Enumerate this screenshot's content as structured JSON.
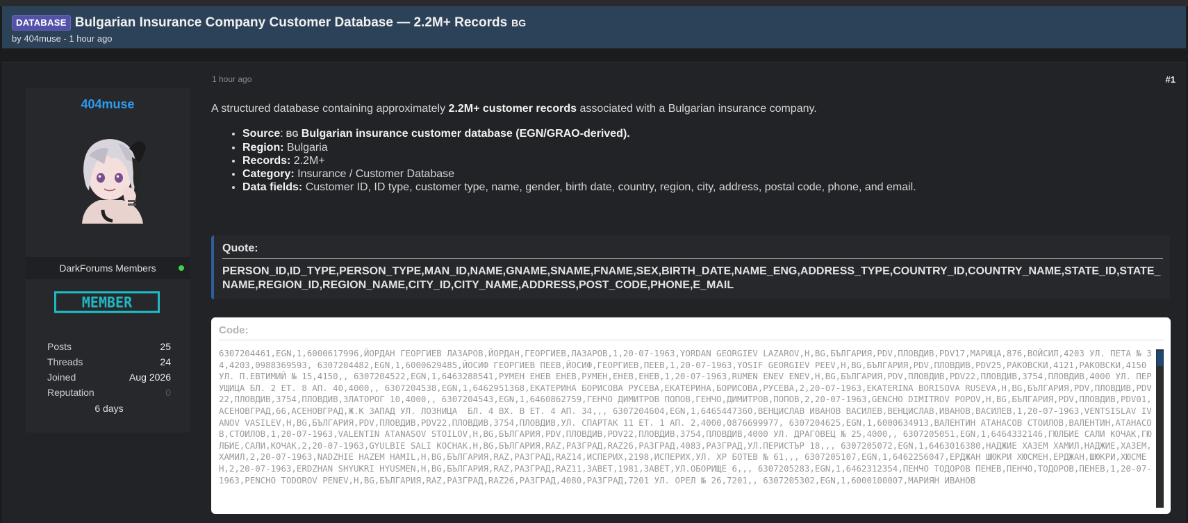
{
  "thread": {
    "prefix": "DATABASE",
    "title": "Bulgarian Insurance Company Customer Database — 2.2M+ Records",
    "flag": "BG",
    "meta": "by 404muse - 1 hour ago"
  },
  "user": {
    "name": "404muse",
    "group": "DarkForums Members",
    "badge": "MEMBER",
    "stats": [
      {
        "label": "Posts",
        "value": "25"
      },
      {
        "label": "Threads",
        "value": "24"
      },
      {
        "label": "Joined",
        "value": "Aug 2026"
      },
      {
        "label": "Reputation",
        "value": "0"
      }
    ],
    "time_online": "6 days"
  },
  "post": {
    "date": "1 hour ago",
    "number": "#1",
    "intro_before": "A structured database containing approximately ",
    "intro_bold": "2.2M+ customer records",
    "intro_after": " associated with a Bulgarian insurance company.",
    "items": [
      {
        "label": "Source",
        "sep": ":",
        "flag": "BG",
        "value": "Bulgarian insurance customer database (EGN/GRAO-derived)."
      },
      {
        "label": "Region:",
        "value": " Bulgaria"
      },
      {
        "label": "Records:",
        "value": " 2.2M+"
      },
      {
        "label": "Category:",
        "value": " Insurance / Customer Database"
      },
      {
        "label": "Data fields:",
        "value": " Customer ID, ID type, customer type, name, gender, birth date, country, region, city, address, postal code, phone, and email."
      }
    ]
  },
  "quote": {
    "title": "Quote:",
    "text": "PERSON_ID,ID_TYPE,PERSON_TYPE,MAN_ID,NAME,GNAME,SNAME,FNAME,SEX,BIRTH_DATE,NAME_ENG,ADDRESS_TYPE,COUNTRY_ID,COUNTRY_NAME,STATE_ID,STATE_NAME,REGION_ID,REGION_NAME,CITY_ID,CITY_NAME,ADDRESS,POST_CODE,PHONE,E_MAIL"
  },
  "code": {
    "title": "Code:",
    "text": "6307204461,EGN,1,6000617996,ЙОРДАН ГЕОРГИЕВ ЛАЗАРОВ,ЙОРДАН,ГЕОРГИЕВ,ЛАЗАРОВ,1,20-07-1963,YORDAN GEORGIEV LAZAROV,H,BG,БЪЛГАРИЯ,PDV,ПЛОВДИВ,PDV17,МАРИЦА,876,ВОЙСИЛ,4203 УЛ. ПЕТА № 34,4203,0988369593, 6307204482,EGN,1,6000629485,ЙОСИФ ГЕОРГИЕВ ПЕЕВ,ЙОСИФ,ГЕОРГИЕВ,ПЕЕВ,1,20-07-1963,YOSIF GEORGIEV PEEV,H,BG,БЪЛГАРИЯ,PDV,ПЛОВДИВ,PDV25,РАКОВСКИ,4121,РАКОВСКИ,4150 УЛ. П.ЕВТИМИЙ № 15,4150,, 6307204522,EGN,1,6463288541,РУМЕН ЕНЕВ ЕНЕВ,РУМЕН,ЕНЕВ,ЕНЕВ,1,20-07-1963,RUMEN ENEV ENEV,H,BG,БЪЛГАРИЯ,PDV,ПЛОВДИВ,PDV22,ПЛОВДИВ,3754,ПЛОВДИВ,4000 УЛ. ПЕРУЩИЦА БЛ. 2 ЕТ. 8 АП. 40,4000,, 6307204538,EGN,1,6462951368,ЕКАТЕРИНА БОРИСОВА РУСЕВА,ЕКАТЕРИНА,БОРИСОВА,РУСЕВА,2,20-07-1963,EKATERINA BORISOVA RUSEVA,H,BG,БЪЛГАРИЯ,PDV,ПЛОВДИВ,PDV22,ПЛОВДИВ,3754,ПЛОВДИВ,ЗЛАТОРОГ 10,4000,, 6307204543,EGN,1,6460862759,ГЕНЧО ДИМИТРОВ ПОПОВ,ГЕНЧО,ДИМИТРОВ,ПОПОВ,2,20-07-1963,GENCHO DIMITROV POPOV,H,BG,БЪЛГАРИЯ,PDV,ПЛОВДИВ,PDV01,АСЕНОВГРАД,66,АСЕНОВГРАД,Ж.К ЗАПАД УЛ. ЛОЗНИЦА  БЛ. 4 ВХ. В ЕТ. 4 АП. 34,,, 6307204604,EGN,1,6465447360,ВЕНЦИСЛАВ ИВАНОВ ВАСИЛЕВ,ВЕНЦИСЛАВ,ИВАНОВ,ВАСИЛЕВ,1,20-07-1963,VENTSISLAV IVANOV VASILEV,H,BG,БЪЛГАРИЯ,PDV,ПЛОВДИВ,PDV22,ПЛОВДИВ,3754,ПЛОВДИВ,УЛ. СПАРТАК 11 ЕТ. 1 АП. 2,4000,0876699977, 6307204625,EGN,1,6000634913,ВАЛЕНТИН АТАНАСОВ СТОИЛОВ,ВАЛЕНТИН,АТАНАСОВ,СТОИЛОВ,1,20-07-1963,VALENTIN ATANASOV STOILOV,H,BG,БЪЛГАРИЯ,PDV,ПЛОВДИВ,PDV22,ПЛОВДИВ,3754,ПЛОВДИВ,4000 УЛ. ДРАГОВЕЦ № 25,4000,, 6307205051,EGN,1,6464332146,ГЮЛБИЕ САЛИ КОЧАК,ГЮЛБИЕ,САЛИ,КОЧАК,2,20-07-1963,GYULBIE SALI KOCHAK,H,BG,БЪЛГАРИЯ,RAZ,РАЗГРАД,RAZ26,РАЗГРАД,4083,РАЗГРАД,УЛ.ПЕРИСТЪР 18,,, 6307205072,EGN,1,6463016380,НАДЖИЕ ХАЗЕМ ХАМИЛ,НАДЖИЕ,ХАЗЕМ,ХАМИЛ,2,20-07-1963,NADZHIE HAZEM HAMIL,H,BG,БЪЛГАРИЯ,RAZ,РАЗГРАД,RAZ14,ИСПЕРИХ,2198,ИСПЕРИХ,УЛ. ХР БОТЕВ № 61,,, 6307205107,EGN,1,6462256047,ЕРДЖАН ШЮКРИ ХЮСМЕН,ЕРДЖАН,ШЮКРИ,ХЮСМЕН,2,20-07-1963,ERDZHAN SHYUKRI HYUSMEN,H,BG,БЪЛГАРИЯ,RAZ,РАЗГРАД,RAZ11,ЗАВЕТ,1981,ЗАВЕТ,УЛ.ОБОРИЩЕ 6,,, 6307205283,EGN,1,6462312354,ПЕНЧО ТОДОРОВ ПЕНЕВ,ПЕНЧО,ТОДОРОВ,ПЕНЕВ,1,20-07-1963,PENCHO TODOROV PENEV,H,BG,БЪЛГАРИЯ,RAZ,РАЗГРАД,RAZ26,РАЗГРАД,4080,РАЗГРАД,7201 УЛ. ОРЕЛ № 26,7201,, 6307205302,EGN,1,6000100007,МАРИЯН ИВАНОВ"
  }
}
